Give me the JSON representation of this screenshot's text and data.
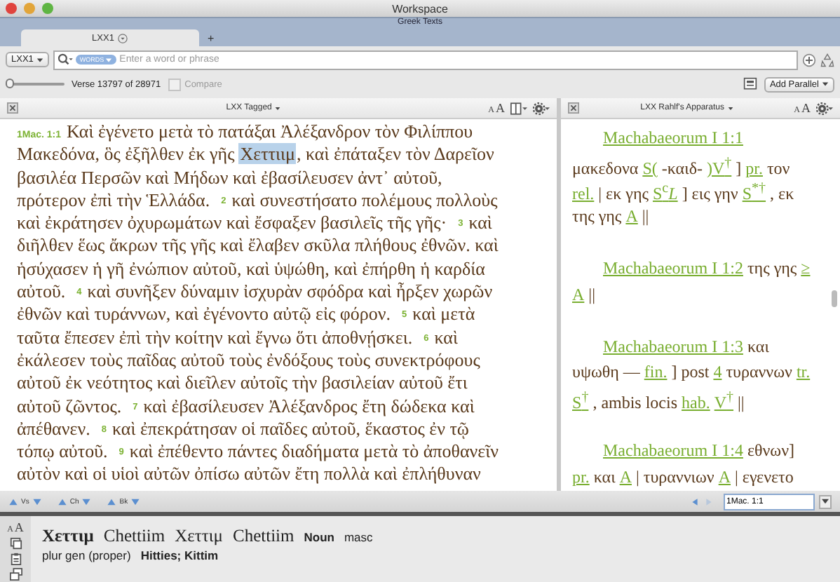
{
  "window": {
    "title": "Workspace"
  },
  "workspace": {
    "title": "Greek Texts",
    "tabs": [
      {
        "label": "LXX1",
        "selected": true
      }
    ],
    "add_tab": "+"
  },
  "search": {
    "resource": "LXX1",
    "token": "WORDS",
    "placeholder": "Enter a word or phrase"
  },
  "verse_bar": {
    "level": 0,
    "label": "Verse 13797 of 28971",
    "compare": {
      "label": "Compare",
      "checked": false,
      "disabled": true
    },
    "add_parallel": "Add Parallel"
  },
  "text_panel": {
    "title": "LXX Tagged",
    "font_size": [
      "A",
      "A"
    ],
    "lines": [
      {
        "segments": [
          {
            "kind": "verse",
            "text": "1Mac. 1:1"
          },
          {
            "kind": "text",
            "text": "Καὶ ἐγένετο μετὰ τὸ πατάξαι Ἀλέξανδρον τὸν Φιλίππου",
            "selected": false
          }
        ]
      },
      {
        "segments": [
          {
            "kind": "text",
            "text": "Μακεδόνα, ὃς ἐξῆλθεν ἐκ γῆς",
            "selected": false
          },
          {
            "kind": "text",
            "text": "Χεττιιμ",
            "selected": true
          },
          {
            "kind": "text",
            "text": ", καὶ ἐπάταξεν τὸν Δαρεῖον",
            "selected": false
          }
        ]
      },
      {
        "segments": [
          {
            "kind": "text",
            "text": "βασιλέα Περσῶν καὶ Μήδων καὶ ἐβασίλευσεν ἀντ᾽ αὐτοῦ,",
            "selected": false
          }
        ]
      },
      {
        "segments": [
          {
            "kind": "text",
            "text": "πρότερον ἐπὶ τὴν Ἑλλάδα.",
            "selected": false
          },
          {
            "kind": "verse",
            "text": "2"
          },
          {
            "kind": "text",
            "text": "καὶ συνεστήσατο πολέμους πολλοὺς",
            "selected": false
          }
        ]
      },
      {
        "segments": [
          {
            "kind": "text",
            "text": "καὶ ἐκράτησεν ὀχυρωμάτων καὶ ἔσφαξεν βασιλεῖς τῆς γῆς·",
            "selected": false
          },
          {
            "kind": "verse",
            "text": "3"
          },
          {
            "kind": "text",
            "text": "καὶ",
            "selected": false
          }
        ]
      },
      {
        "segments": [
          {
            "kind": "text",
            "text": "διῆλθεν ἕως ἄκρων τῆς γῆς καὶ ἔλαβεν σκῦλα πλήθους ἐθνῶν. καὶ",
            "selected": false
          }
        ]
      },
      {
        "segments": [
          {
            "kind": "text",
            "text": "ἡσύχασεν ἡ γῆ ἐνώπιον αὐτοῦ, καὶ ὑψώθη, καὶ ἐπήρθη ἡ καρδία",
            "selected": false
          }
        ]
      },
      {
        "segments": [
          {
            "kind": "text",
            "text": "αὐτοῦ.",
            "selected": false
          },
          {
            "kind": "verse",
            "text": "4"
          },
          {
            "kind": "text",
            "text": "καὶ συνῆξεν δύναμιν ἰσχυρὰν σφόδρα καὶ ἦρξεν χωρῶν",
            "selected": false
          }
        ]
      },
      {
        "segments": [
          {
            "kind": "text",
            "text": "ἐθνῶν καὶ τυράννων, καὶ ἐγένοντο αὐτῷ εἰς φόρον.",
            "selected": false
          },
          {
            "kind": "verse",
            "text": "5"
          },
          {
            "kind": "text",
            "text": "καὶ μετὰ",
            "selected": false
          }
        ]
      },
      {
        "segments": [
          {
            "kind": "text",
            "text": "ταῦτα ἔπεσεν ἐπὶ τὴν κοίτην καὶ ἔγνω ὅτι ἀποθνῄσκει.",
            "selected": false
          },
          {
            "kind": "verse",
            "text": "6"
          },
          {
            "kind": "text",
            "text": "καὶ",
            "selected": false
          }
        ]
      },
      {
        "segments": [
          {
            "kind": "text",
            "text": "ἐκάλεσεν τοὺς παῖδας αὐτοῦ τοὺς ἐνδόξους τοὺς συνεκτρόφους",
            "selected": false
          }
        ]
      },
      {
        "segments": [
          {
            "kind": "text",
            "text": "αὐτοῦ ἐκ νεότητος καὶ διεῖλεν αὐτοῖς τὴν βασιλείαν αὐτοῦ ἔτι",
            "selected": false
          }
        ]
      },
      {
        "segments": [
          {
            "kind": "text",
            "text": "αὐτοῦ ζῶντος.",
            "selected": false
          },
          {
            "kind": "verse",
            "text": "7"
          },
          {
            "kind": "text",
            "text": "καὶ ἐβασίλευσεν Ἀλέξανδρος ἔτη δώδεκα καὶ",
            "selected": false
          }
        ]
      },
      {
        "segments": [
          {
            "kind": "text",
            "text": "ἀπέθανεν.",
            "selected": false
          },
          {
            "kind": "verse",
            "text": "8"
          },
          {
            "kind": "text",
            "text": "καὶ ἐπεκράτησαν οἱ παῖδες αὐτοῦ, ἕκαστος ἐν τῷ",
            "selected": false
          }
        ]
      },
      {
        "segments": [
          {
            "kind": "text",
            "text": "τόπῳ αὐτοῦ.",
            "selected": false
          },
          {
            "kind": "verse",
            "text": "9"
          },
          {
            "kind": "text",
            "text": "καὶ ἐπέθεντο πάντες διαδήματα μετὰ τὸ ἀποθανεῖν",
            "selected": false
          }
        ]
      },
      {
        "segments": [
          {
            "kind": "text",
            "text": "αὐτὸν καὶ οἱ υἱοὶ αὐτῶν ὀπίσω αὐτῶν ἔτη πολλὰ καὶ ἐπλήθυναν",
            "selected": false
          }
        ]
      }
    ]
  },
  "apparatus_panel": {
    "title": "LXX Rahlf's Apparatus",
    "font_size": [
      "A",
      "A"
    ],
    "entries": [
      {
        "lines": [
          {
            "segments": [
              {
                "kind": "reference",
                "text": "Machabaeorum I 1:1"
              }
            ]
          },
          {
            "segments": [
              {
                "kind": "text",
                "text": "μακεδονα"
              },
              {
                "kind": "link",
                "text": "S("
              },
              {
                "kind": "text",
                "text": "-καιδ-"
              },
              {
                "kind": "link",
                "text": ")V$^{†}$"
              },
              {
                "kind": "text",
                "text": "]"
              },
              {
                "kind": "link",
                "text": "pr."
              },
              {
                "kind": "text",
                "text": "τον"
              }
            ]
          },
          {
            "segments": [
              {
                "kind": "link",
                "text": "rel."
              },
              {
                "kind": "text",
                "text": "| εκ γης"
              },
              {
                "kind": "link",
                "text": "S$^{c}$*L*"
              },
              {
                "kind": "text",
                "text": "] εις γην"
              },
              {
                "kind": "link",
                "text": "S$^{*†}$"
              },
              {
                "kind": "text",
                "text": ", εκ"
              }
            ]
          },
          {
            "segments": [
              {
                "kind": "text",
                "text": "της γης"
              },
              {
                "kind": "link",
                "text": "A"
              },
              {
                "kind": "text",
                "text": "||"
              }
            ]
          }
        ]
      },
      {
        "lines": [
          {
            "segments": [
              {
                "kind": "reference",
                "text": "Machabaeorum I 1:2"
              },
              {
                "kind": "text",
                "text": "της γης"
              },
              {
                "kind": "link",
                "text": "≥"
              }
            ]
          },
          {
            "segments": [
              {
                "kind": "link",
                "text": "A"
              },
              {
                "kind": "text",
                "text": "||"
              }
            ]
          }
        ]
      },
      {
        "lines": [
          {
            "segments": [
              {
                "kind": "reference",
                "text": "Machabaeorum I 1:3"
              },
              {
                "kind": "text",
                "text": "και"
              }
            ]
          },
          {
            "segments": [
              {
                "kind": "text",
                "text": "υψωθη —"
              },
              {
                "kind": "link",
                "text": "fin."
              },
              {
                "kind": "text",
                "text": "] post"
              },
              {
                "kind": "link",
                "text": "4"
              },
              {
                "kind": "text",
                "text": "τυραννων"
              },
              {
                "kind": "link",
                "text": "tr."
              }
            ]
          },
          {
            "segments": [
              {
                "kind": "link",
                "text": "S$^{†}$"
              },
              {
                "kind": "text",
                "text": ", ambis locis"
              },
              {
                "kind": "link",
                "text": "hab."
              },
              {
                "kind": "link",
                "text": "V$^{†}$"
              },
              {
                "kind": "text",
                "text": "||"
              }
            ]
          }
        ]
      },
      {
        "lines": [
          {
            "segments": [
              {
                "kind": "reference",
                "text": "Machabaeorum I 1:4"
              },
              {
                "kind": "text",
                "text": "εθνων]"
              }
            ]
          },
          {
            "segments": [
              {
                "kind": "link",
                "text": "pr."
              },
              {
                "kind": "text",
                "text": "και"
              },
              {
                "kind": "link",
                "text": "A"
              },
              {
                "kind": "text",
                "text": "| τυραννιων"
              },
              {
                "kind": "link",
                "text": "A"
              },
              {
                "kind": "text",
                "text": "| εγενετο"
              }
            ]
          }
        ]
      }
    ]
  },
  "nav": {
    "steps": [
      "Vs",
      "Ch",
      "Bk"
    ],
    "reference": "1Mac. 1:1"
  },
  "lexicon": {
    "font_size": [
      "A",
      "A"
    ],
    "headword": "Χεττιμ",
    "transliteration": "Chettiim",
    "lemma": "Χεττιμ",
    "lemma_transliteration": "Chettiim",
    "part_of_speech": "Noun",
    "gender": "masc",
    "parsing": "plur gen (proper)",
    "gloss": "Hitties; Kittim"
  }
}
